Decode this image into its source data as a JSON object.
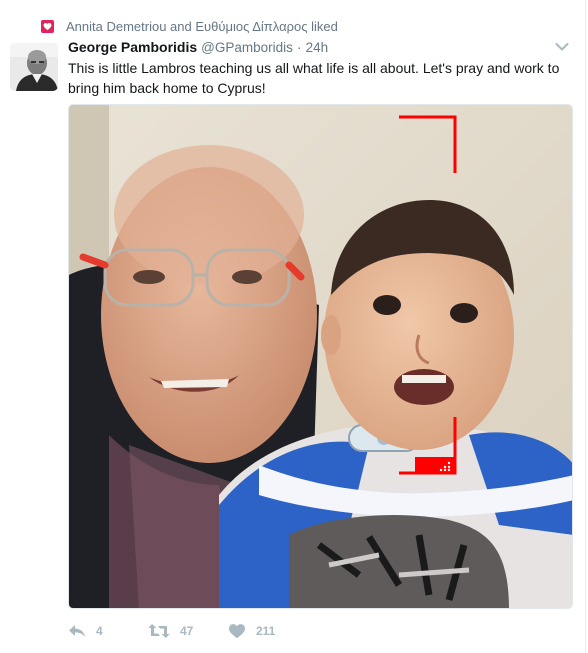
{
  "context": {
    "text": "Annita Demetriou and Ευθύμιος Δίπλαρος liked",
    "icon": "heart-icon"
  },
  "tweet": {
    "fullname": "George Pamboridis",
    "username": "@GPamboridis",
    "separator": "·",
    "time": "24h",
    "text": "This is little Lambros teaching us all what life is all about. Let's pray and work to bring him back home to Cyprus!"
  },
  "actions": {
    "reply_count": "4",
    "retweet_count": "47",
    "like_count": "211"
  },
  "colors": {
    "like": "#e0245e",
    "muted": "#657786",
    "action": "#aab8c2",
    "annotation": "#ff0000"
  }
}
